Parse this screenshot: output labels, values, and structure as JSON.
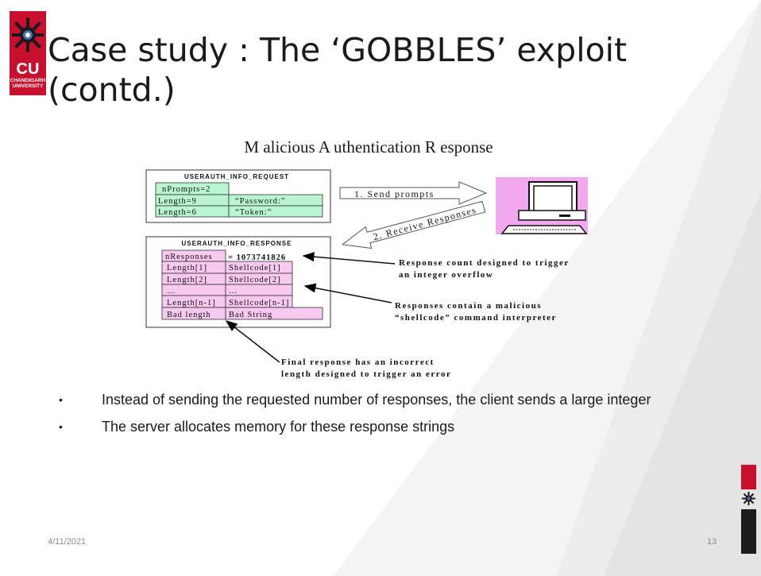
{
  "logo": {
    "abbrev": "CU",
    "name_line1": "CHANDIGARH",
    "name_line2": "UNIVERSITY"
  },
  "title": "Case study : The ‘GOBBLES’ exploit (contd.)",
  "diagram": {
    "heading": "M alicious  A uthentication  R esponse",
    "request_box": {
      "header": "USERAUTH_INFO_REQUEST",
      "rows": [
        {
          "left": "nPrompts=2",
          "right": ""
        },
        {
          "left": "Length=9",
          "right": "“Password:”"
        },
        {
          "left": "Length=6",
          "right": "“Token:”"
        }
      ]
    },
    "response_box": {
      "header": "USERAUTH_INFO_RESPONSE",
      "rows": [
        {
          "left": "nResponses",
          "right": "= 1073741826"
        },
        {
          "left": "Length[1]",
          "right": "Shellcode[1]"
        },
        {
          "left": "Length[2]",
          "right": "Shellcode[2]"
        },
        {
          "left": "…",
          "right": "…"
        },
        {
          "left": "Length[n-1]",
          "right": "Shellcode[n-1]"
        },
        {
          "left": "Bad length",
          "right": "Bad String"
        }
      ]
    },
    "arrow_send": "1. Send prompts",
    "arrow_receive": "2. Receive Responses",
    "annotation_count_line1": "Response count designed to trigger",
    "annotation_count_line2": "an integer overflow",
    "annotation_shellcode_line1": "Responses contain a malicious",
    "annotation_shellcode_line2": "“shellcode” command interpreter",
    "annotation_final_line1": "Final response has an incorrect",
    "annotation_final_line2": "length designed to trigger an error"
  },
  "bullets": [
    "Instead of sending the requested number of responses, the client sends a large integer",
    "The server allocates memory for these response strings"
  ],
  "footer": {
    "date": "4/11/2021",
    "page": "13"
  },
  "colors": {
    "brand_red": "#c8102e",
    "cell_green": "#b8f5d0",
    "cell_pink": "#f7c8f0",
    "computer_bg": "#f2a8ef"
  }
}
